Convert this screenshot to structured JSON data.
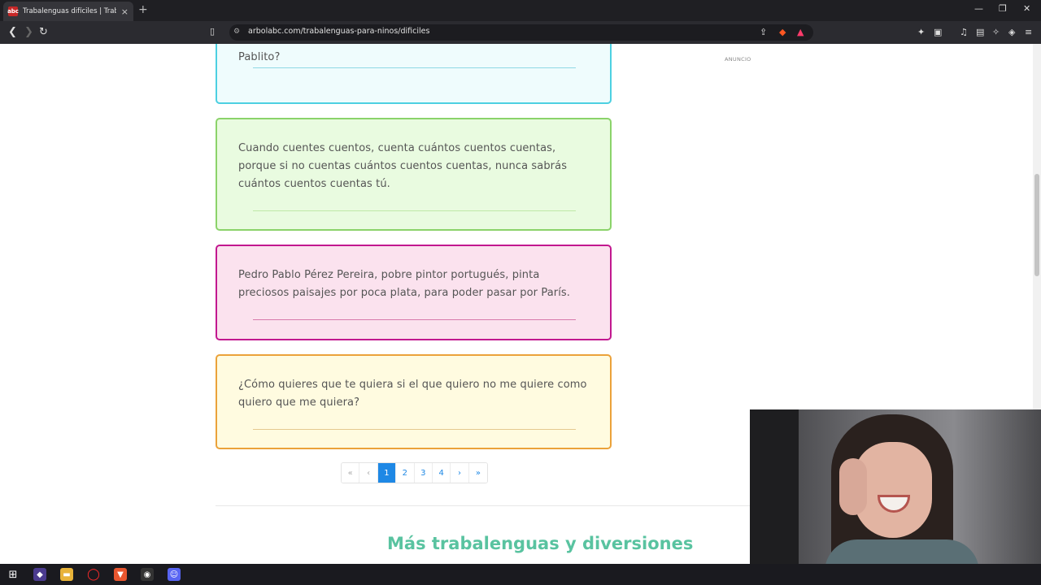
{
  "browser": {
    "tab_title": "Trabalenguas difíciles | Trabalen",
    "tab_favicon_text": "abc",
    "url": "arbolabc.com/trabalenguas-para-ninos/dificiles",
    "new_tab_label": "+",
    "close_tab_label": "×",
    "window_controls": [
      "—",
      "❐",
      "✕"
    ]
  },
  "page": {
    "ad_label": "ANUNCIO",
    "cards": [
      {
        "text": "Pablito?",
        "border_color": "#4dd0e1",
        "bg_color": "#effcfd",
        "rule_color": "#8fd9e4"
      },
      {
        "text": "Cuando cuentes cuentos, cuenta cuántos cuentos cuentas, porque si no cuentas cuántos cuentos cuentas, nunca sabrás cuántos cuentos cuentas tú.",
        "border_color": "#8bd36a",
        "bg_color": "#e9fbe0",
        "rule_color": "#bfe8a8"
      },
      {
        "text": "Pedro Pablo Pérez Pereira, pobre pintor portugués, pinta preciosos paisajes por poca plata, para poder pasar por París.",
        "border_color": "#c2188f",
        "bg_color": "#fbe2ee",
        "rule_color": "#d77aab"
      },
      {
        "text": "¿Cómo quieres que te quiera si el que quiero no me quiere como quiero que me quiera?",
        "border_color": "#eba23a",
        "bg_color": "#fffbe0",
        "rule_color": "#e5c98f"
      }
    ],
    "pagination": {
      "items": [
        "«",
        "‹",
        "1",
        "2",
        "3",
        "4",
        "›",
        "»"
      ],
      "active": "1"
    },
    "more_title": "Más trabalenguas y diversiones"
  },
  "colors": {
    "accent": "#1e88e5",
    "heading": "#59c3a0"
  }
}
